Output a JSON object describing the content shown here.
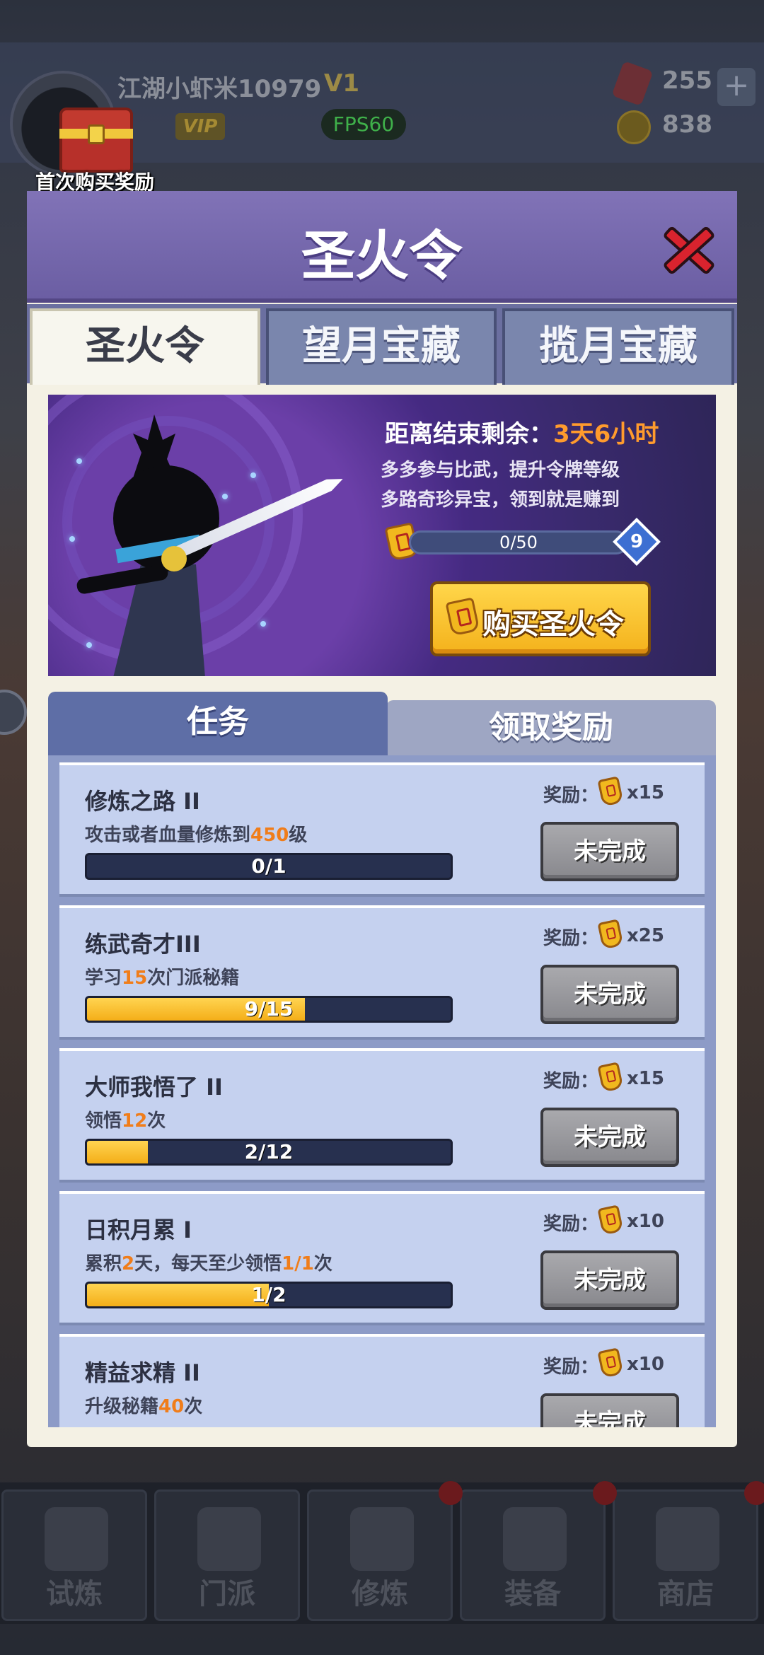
{
  "player": {
    "name": "江湖小虾米10979",
    "vip_level": "V1",
    "vip_badge": "VIP",
    "fps": "FPS60"
  },
  "resources": {
    "gems": "255",
    "coins": "838",
    "plus": "+"
  },
  "first_purchase": {
    "label": "首次购买奖励"
  },
  "modal": {
    "title": "圣火令",
    "tabs": [
      {
        "label": "圣火令",
        "active": true
      },
      {
        "label": "望月宝藏",
        "active": false
      },
      {
        "label": "揽月宝藏",
        "active": false
      }
    ],
    "banner": {
      "countdown_prefix": "距离结束剩余：",
      "countdown_value": "3天6小时",
      "line1": "多多参与比武，提升令牌等级",
      "line2": "多路奇珍异宝，领到就是赚到",
      "progress_text": "0/50",
      "progress": 0.0,
      "level": "9",
      "buy_label": "购买圣火令"
    },
    "subtabs": [
      {
        "label": "任务",
        "active": true
      },
      {
        "label": "领取奖励",
        "active": false
      }
    ],
    "reward_label": "奖励：",
    "tasks": [
      {
        "name": "修炼之路 II",
        "desc_pre": "攻击或者血量修炼到",
        "desc_num": "450",
        "desc_post": "级",
        "desc_num2": "",
        "desc_post2": "",
        "progress_text": "0/1",
        "progress": 0.0,
        "reward_qty": "x15",
        "status": "未完成"
      },
      {
        "name": "练武奇才III",
        "desc_pre": "学习",
        "desc_num": "15",
        "desc_post": "次门派秘籍",
        "desc_num2": "",
        "desc_post2": "",
        "progress_text": "9/15",
        "progress": 0.6,
        "reward_qty": "x25",
        "status": "未完成"
      },
      {
        "name": "大师我悟了 II",
        "desc_pre": "领悟",
        "desc_num": "12",
        "desc_post": "次",
        "desc_num2": "",
        "desc_post2": "",
        "progress_text": "2/12",
        "progress": 0.1667,
        "reward_qty": "x15",
        "status": "未完成"
      },
      {
        "name": "日积月累 I",
        "desc_pre": "累积",
        "desc_num": "2",
        "desc_post": "天，每天至少领悟",
        "desc_num2": "1/1",
        "desc_post2": "次",
        "progress_text": "1/2",
        "progress": 0.5,
        "reward_qty": "x10",
        "status": "未完成"
      },
      {
        "name": "精益求精 II",
        "desc_pre": "升级秘籍",
        "desc_num": "40",
        "desc_post": "次",
        "desc_num2": "",
        "desc_post2": "",
        "progress_text": "",
        "progress": 0.0,
        "reward_qty": "x10",
        "status": "未完成"
      }
    ]
  },
  "bottom_nav": [
    {
      "label": "试炼",
      "icon": "ninja-icon"
    },
    {
      "label": "门派",
      "icon": "temple-icon"
    },
    {
      "label": "修炼",
      "icon": "book-icon"
    },
    {
      "label": "装备",
      "icon": "sword-icon"
    },
    {
      "label": "商店",
      "icon": "shop-icon"
    }
  ],
  "colors": {
    "accent_orange": "#f07d1a",
    "header_purple": "#7466ad",
    "progress_gold": "#f4ae18",
    "close_red": "#d9232e"
  }
}
